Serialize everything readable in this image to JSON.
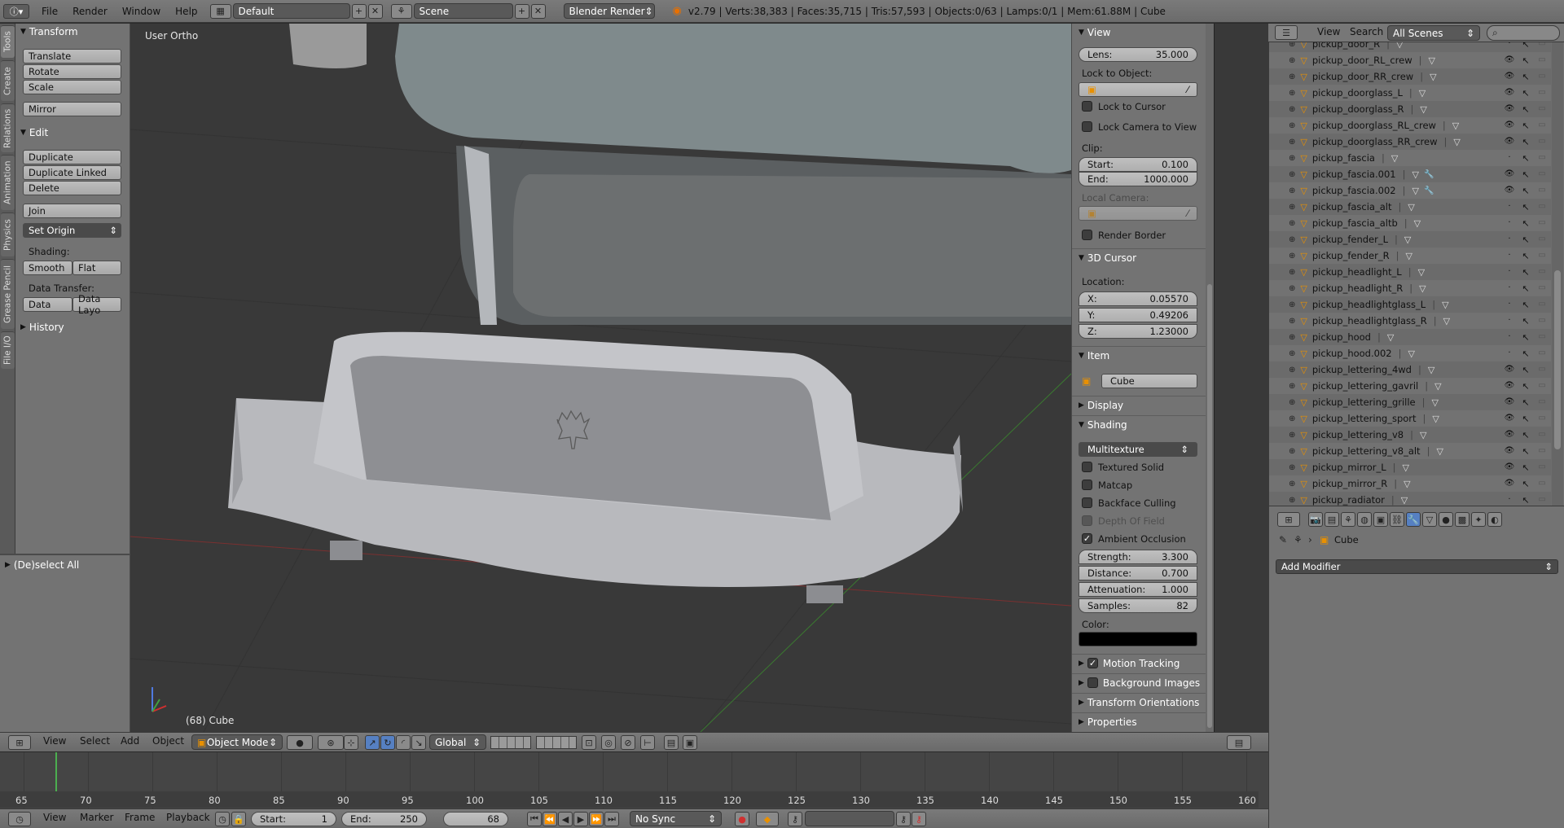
{
  "topbar": {
    "menus": [
      "File",
      "Render",
      "Window",
      "Help"
    ],
    "layout": "Default",
    "scene": "Scene",
    "engine": "Blender Render",
    "stats": "v2.79 | Verts:38,383 | Faces:35,715 | Tris:57,593 | Objects:0/63 | Lamps:0/1 | Mem:61.88M | Cube"
  },
  "left_tabs": [
    "Tools",
    "Create",
    "Relations",
    "Animation",
    "Physics",
    "Grease Pencil",
    "File I/O"
  ],
  "toolshelf": {
    "transform_title": "Transform",
    "translate": "Translate",
    "rotate": "Rotate",
    "scale": "Scale",
    "mirror": "Mirror",
    "edit_title": "Edit",
    "duplicate": "Duplicate",
    "duplicate_linked": "Duplicate Linked",
    "delete": "Delete",
    "join": "Join",
    "set_origin": "Set Origin",
    "shading_label": "Shading:",
    "smooth": "Smooth",
    "flat": "Flat",
    "data_transfer_label": "Data Transfer:",
    "data": "Data",
    "data_layo": "Data Layo",
    "history_title": "History",
    "deselect_all": "(De)select All"
  },
  "viewport": {
    "view_label": "User Ortho",
    "object_label": "(68) Cube"
  },
  "npanel": {
    "view_title": "View",
    "lens_label": "Lens:",
    "lens_value": "35.000",
    "lock_to_object": "Lock to Object:",
    "lock_to_cursor": "Lock to Cursor",
    "lock_camera": "Lock Camera to View",
    "clip_label": "Clip:",
    "start_label": "Start:",
    "start_value": "0.100",
    "end_label": "End:",
    "end_value": "1000.000",
    "local_camera": "Local Camera:",
    "render_border": "Render Border",
    "cursor_title": "3D Cursor",
    "location_label": "Location:",
    "x_label": "X:",
    "x_value": "0.05570",
    "y_label": "Y:",
    "y_value": "0.49206",
    "z_label": "Z:",
    "z_value": "1.23000",
    "item_title": "Item",
    "item_name": "Cube",
    "display_title": "Display",
    "shading_title": "Shading",
    "shading_mode": "Multitexture",
    "textured_solid": "Textured Solid",
    "matcap": "Matcap",
    "backface_culling": "Backface Culling",
    "depth_of_field": "Depth Of Field",
    "ambient_occlusion": "Ambient Occlusion",
    "strength_label": "Strength:",
    "strength_value": "3.300",
    "distance_label": "Distance:",
    "distance_value": "0.700",
    "attenuation_label": "Attenuation:",
    "attenuation_value": "1.000",
    "samples_label": "Samples:",
    "samples_value": "82",
    "color_label": "Color:",
    "motion_tracking": "Motion Tracking",
    "background_images": "Background Images",
    "transform_orientations": "Transform Orientations",
    "properties": "Properties"
  },
  "outliner": {
    "view": "View",
    "search": "Search",
    "scenes": "All Scenes",
    "items": [
      "pickup_door_R",
      "pickup_door_RL_crew",
      "pickup_door_RR_crew",
      "pickup_doorglass_L",
      "pickup_doorglass_R",
      "pickup_doorglass_RL_crew",
      "pickup_doorglass_RR_crew",
      "pickup_fascia",
      "pickup_fascia.001",
      "pickup_fascia.002",
      "pickup_fascia_alt",
      "pickup_fascia_altb",
      "pickup_fender_L",
      "pickup_fender_R",
      "pickup_headlight_L",
      "pickup_headlight_R",
      "pickup_headlightglass_L",
      "pickup_headlightglass_R",
      "pickup_hood",
      "pickup_hood.002",
      "pickup_lettering_4wd",
      "pickup_lettering_gavril",
      "pickup_lettering_grille",
      "pickup_lettering_sport",
      "pickup_lettering_v8",
      "pickup_lettering_v8_alt",
      "pickup_mirror_L",
      "pickup_mirror_R",
      "pickup_radiator"
    ]
  },
  "properties_editor": {
    "object_name": "Cube",
    "add_modifier": "Add Modifier"
  },
  "viewport_header": {
    "menus": [
      "View",
      "Select",
      "Add",
      "Object"
    ],
    "mode": "Object Mode",
    "orientation": "Global"
  },
  "timeline": {
    "ticks": [
      "65",
      "70",
      "75",
      "80",
      "85",
      "90",
      "95",
      "100",
      "105",
      "110",
      "115",
      "120",
      "125",
      "130",
      "135",
      "140",
      "145",
      "150",
      "155",
      "160"
    ],
    "menus": [
      "View",
      "Marker",
      "Frame",
      "Playback"
    ],
    "start_label": "Start:",
    "start_value": "1",
    "end_label": "End:",
    "end_value": "250",
    "current_frame": "68",
    "sync": "No Sync"
  },
  "colors": {
    "panel_bg": "#737373",
    "viewport_bg": "#393939",
    "accent_blue": "#5680c2",
    "selected_orange": "#f0a000"
  }
}
